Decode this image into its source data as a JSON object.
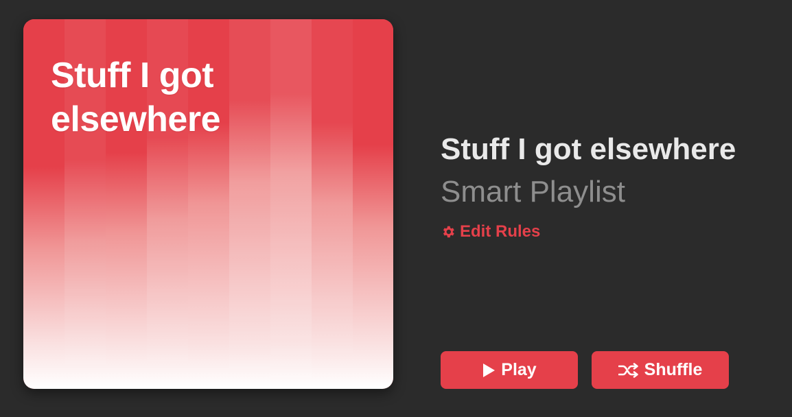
{
  "artwork": {
    "title": "Stuff I got elsewhere",
    "color": "#e5404a"
  },
  "playlist": {
    "title": "Stuff I got elsewhere",
    "type": "Smart Playlist"
  },
  "edit_rules": {
    "label": "Edit Rules",
    "icon": "gear-icon"
  },
  "actions": {
    "play_label": "Play",
    "play_icon": "play-icon",
    "shuffle_label": "Shuffle",
    "shuffle_icon": "shuffle-icon"
  },
  "colors": {
    "background": "#2b2b2b",
    "accent": "#e5404a",
    "title": "#e9e9e9",
    "subtitle": "#8e8e8e"
  }
}
